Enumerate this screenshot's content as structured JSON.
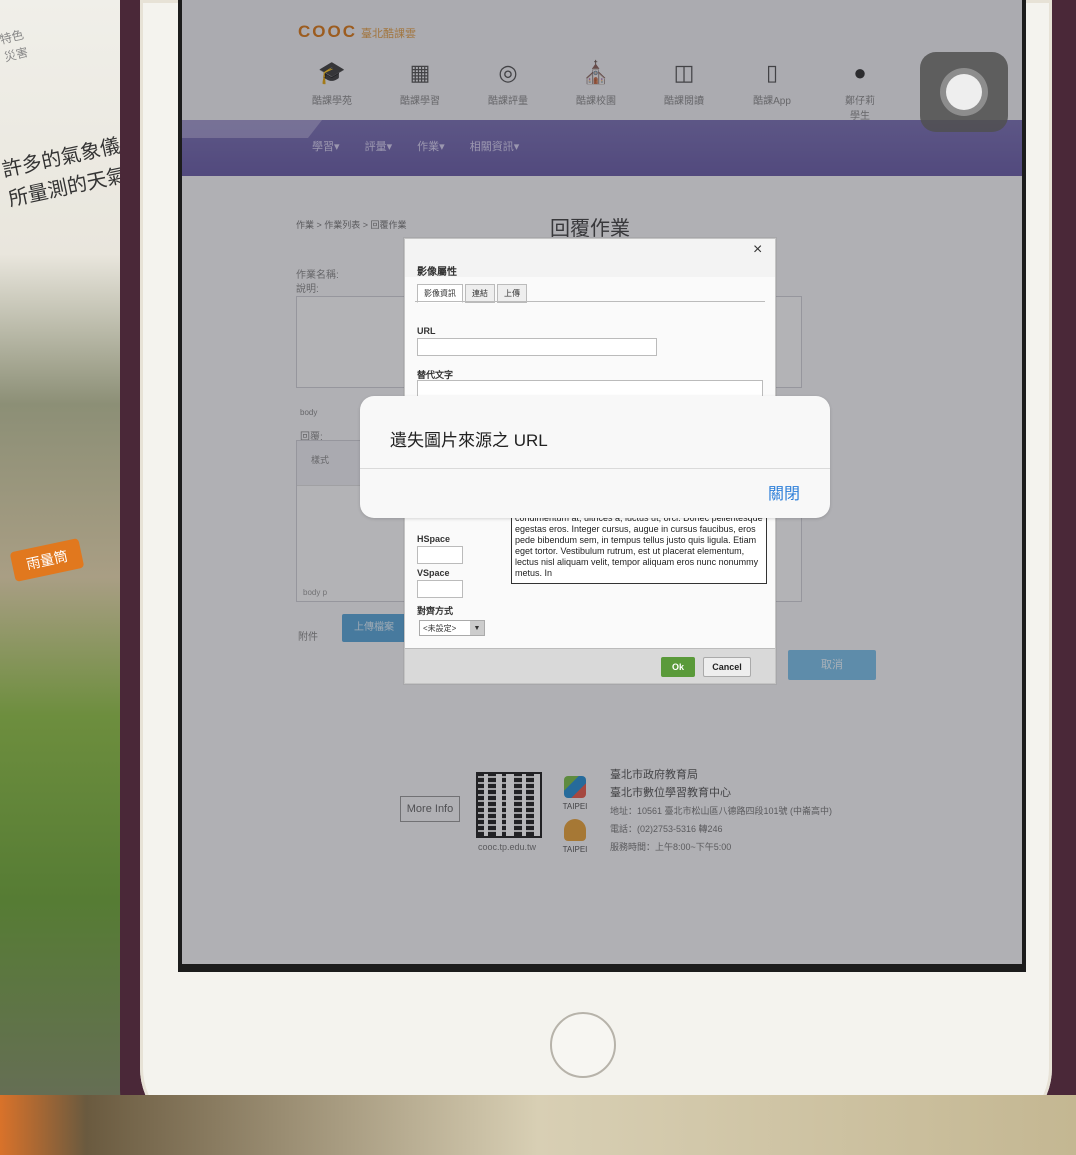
{
  "photo": {
    "poster_top": "特色\n災害",
    "poster_text": "許多的氣象儀器\n所量測的天氣因",
    "bubble": "雨量筒"
  },
  "site": {
    "logo": "COOC",
    "logo_sub": "臺北酷課雲",
    "nav": [
      {
        "label": "酷課學苑",
        "icon": "graduation-cap-icon"
      },
      {
        "label": "酷課學習",
        "icon": "book-icon"
      },
      {
        "label": "酷課評量",
        "icon": "target-icon"
      },
      {
        "label": "酷課校園",
        "icon": "school-icon"
      },
      {
        "label": "酷課閱讀",
        "icon": "reading-icon"
      },
      {
        "label": "酷課App",
        "icon": "phone-icon"
      },
      {
        "label": "鄭仔莉\n學生",
        "icon": "user-icon"
      }
    ],
    "menu": "學習▾ 評量▾ 作業▾ 相關資訊▾",
    "breadcrumb": "作業 > 作業列表 > 回覆作業",
    "page_title": "回覆作業",
    "label_name": "作業名稱:",
    "label_desc": "說明:",
    "label_body": "body",
    "label_reply": "回覆:",
    "label_style": "樣式",
    "editor_status": "body  p",
    "label_attach": "附件",
    "upload_btn": "上傳檔案",
    "cancel_btn": "取消"
  },
  "footer": {
    "more_info": "More Info",
    "qr_url": "cooc.tp.edu.tw",
    "taipei_a": "TAIPEI",
    "taipei_b": "TAIPEI",
    "org1": "臺北市政府教育局",
    "org2": "臺北市數位學習教育中心",
    "addr": "地址：10561 臺北市松山區八德路四段101號 (中崙高中)",
    "phone": "電話：(02)2753-5316 轉246",
    "hours": "服務時間：上午8:00~下午5:00"
  },
  "image_dialog": {
    "title": "影像屬性",
    "close": "×",
    "tabs": [
      "影像資訊",
      "連結",
      "上傳"
    ],
    "url_label": "URL",
    "alt_label": "替代文字",
    "hspace_label": "HSpace",
    "vspace_label": "VSpace",
    "align_label": "對齊方式",
    "align_value": "<未設定>",
    "preview_text": "condimentum at, ultrices a, luctus ut, orci. Donec pellentesque egestas eros. Integer cursus, augue in cursus faucibus, eros pede bibendum sem, in tempus tellus justo quis ligula. Etiam eget tortor. Vestibulum rutrum, est ut placerat elementum, lectus nisl aliquam velit, tempor aliquam eros nunc nonummy metus. In",
    "ok": "Ok",
    "cancel": "Cancel"
  },
  "alert": {
    "message": "遺失圖片來源之 URL",
    "close": "關閉",
    "accent": "#2b7ed9"
  }
}
